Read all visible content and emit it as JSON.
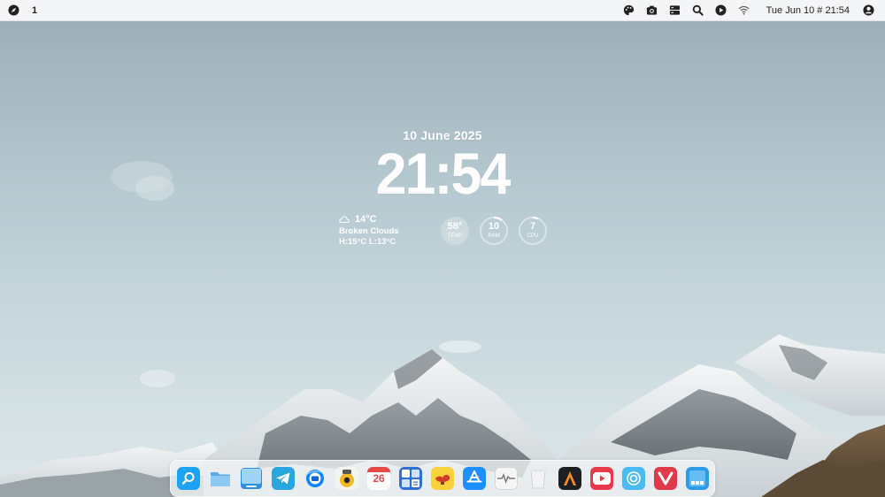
{
  "topbar": {
    "workspace": "1",
    "datetime": "Tue Jun 10 # 21:54",
    "left_icons": [
      "compass-icon"
    ],
    "right_icons": [
      "palette-icon",
      "camera-icon",
      "server-icon",
      "search-icon",
      "play-icon",
      "wifi-icon",
      "account-icon"
    ]
  },
  "widget": {
    "date": "10 June 2025",
    "time": "21:54",
    "weather": {
      "temp": "14°C",
      "condition": "Broken Clouds",
      "high_low": "H:15°C  L:13°C",
      "icon": "cloud-icon"
    },
    "stats": [
      {
        "value": "58°",
        "label": "TEMP",
        "fraction": 0.58
      },
      {
        "value": "10",
        "label": "RAM",
        "fraction": 0.1
      },
      {
        "value": "7",
        "label": "CPU",
        "fraction": 0.07
      }
    ]
  },
  "dock": {
    "items": [
      {
        "name": "finder-search-icon",
        "calendar_day": ""
      },
      {
        "name": "files-icon",
        "calendar_day": ""
      },
      {
        "name": "desktop-icon",
        "calendar_day": ""
      },
      {
        "name": "telegram-icon",
        "calendar_day": ""
      },
      {
        "name": "thunderbird-icon",
        "calendar_day": ""
      },
      {
        "name": "rhythmbox-icon",
        "calendar_day": ""
      },
      {
        "name": "calendar-icon",
        "calendar_day": "26"
      },
      {
        "name": "calculator-icon",
        "calendar_day": ""
      },
      {
        "name": "genie-icon",
        "calendar_day": ""
      },
      {
        "name": "app-store-icon",
        "calendar_day": ""
      },
      {
        "name": "activity-monitor-icon",
        "calendar_day": ""
      },
      {
        "name": "trash-icon",
        "calendar_day": ""
      },
      {
        "name": "alacritty-icon",
        "calendar_day": ""
      },
      {
        "name": "youtube-icon",
        "calendar_day": ""
      },
      {
        "name": "browser-icon",
        "calendar_day": ""
      },
      {
        "name": "vivaldi-icon",
        "calendar_day": ""
      },
      {
        "name": "launchpad-icon",
        "calendar_day": ""
      }
    ]
  },
  "colors": {
    "topbar_bg": "#f4f5f7",
    "accent_blue": "#1e9bf0",
    "youtube_red": "#e8394a",
    "vivaldi_red": "#e0394a"
  }
}
